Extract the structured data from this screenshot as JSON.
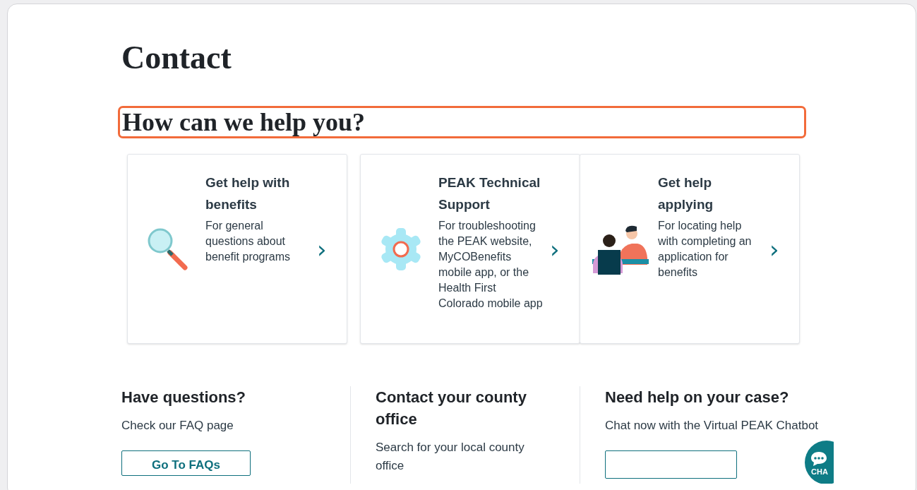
{
  "page": {
    "title": "Contact",
    "highlighted_heading": "How can we help you?"
  },
  "cards": [
    {
      "kind": "magnifier",
      "title": "Get help with benefits",
      "description": "For general questions about benefit programs",
      "chevron": "›"
    },
    {
      "kind": "gear",
      "title": "PEAK Technical Support",
      "description": "For troubleshooting the PEAK website, MyCOBenefits mobile app, or the Health First Colorado mobile app",
      "chevron": "›"
    },
    {
      "kind": "people",
      "title": "Get help applying",
      "description": "For locating help with completing an application for benefits",
      "chevron": "›"
    }
  ],
  "sections": [
    {
      "heading": "Have questions?",
      "text": "Check our FAQ page",
      "button": "Go To FAQs"
    },
    {
      "heading": "Contact your county office",
      "text": "Search for your local county office"
    },
    {
      "heading": "Need help on your case?",
      "text": "Chat now with the Virtual PEAK Chatbot",
      "has_button": true
    }
  ],
  "chat_button": {
    "label": "CHA"
  }
}
